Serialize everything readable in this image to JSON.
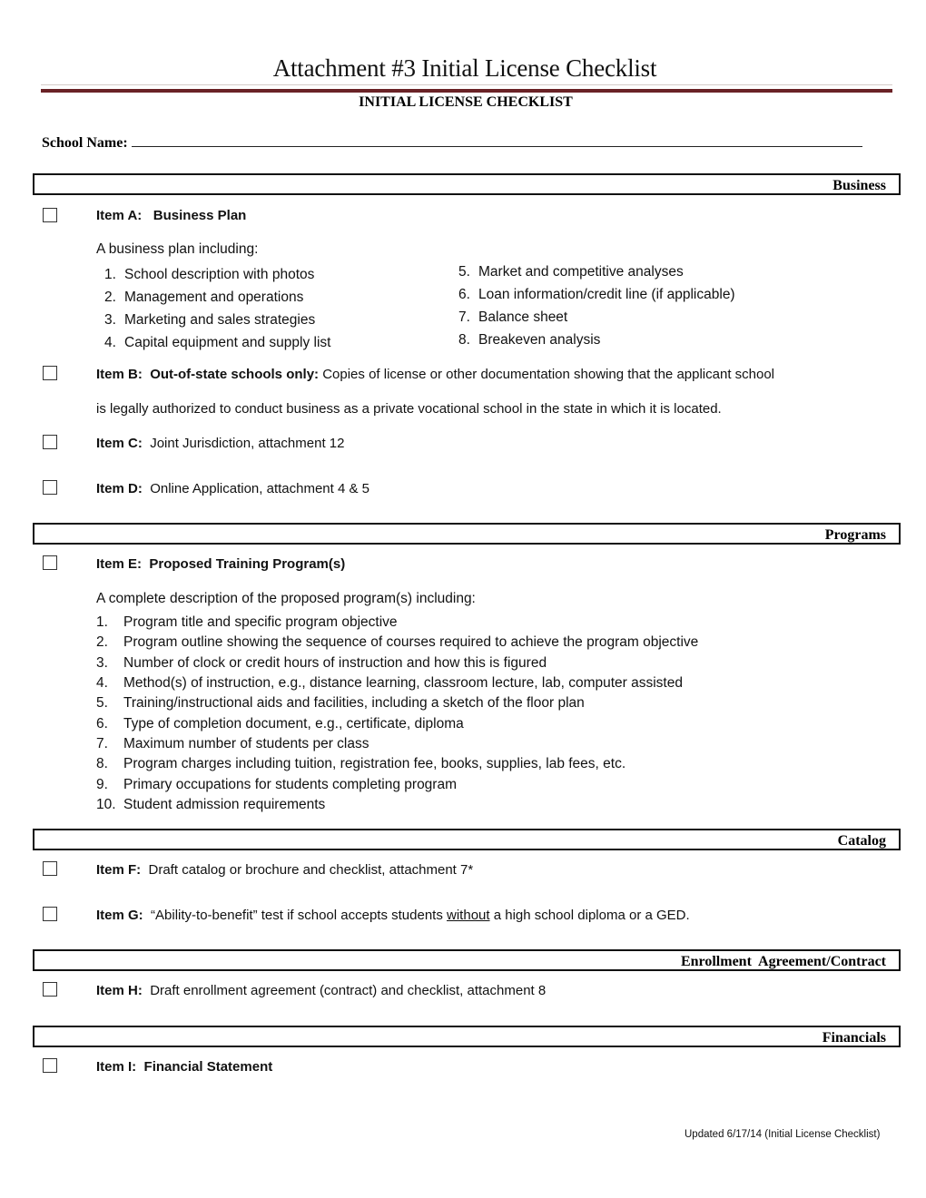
{
  "header": {
    "title": "Attachment #3  Initial License Checklist",
    "subtitle": "INITIAL LICENSE CHECKLIST",
    "rule_colors": {
      "thin": "#d4ccc8",
      "thick": "#6a2226"
    }
  },
  "school_name": {
    "label": "School Name:",
    "value": ""
  },
  "sections": {
    "business": {
      "heading": "Business",
      "item_a": {
        "label": "Item A:",
        "title": "Business Plan",
        "intro": "A business plan including:",
        "list_left": [
          {
            "n": "1.",
            "text": "School description with photos"
          },
          {
            "n": "2.",
            "text": "Management and operations"
          },
          {
            "n": "3.",
            "text": "Marketing and sales strategies"
          },
          {
            "n": "4.",
            "text": "Capital equipment and supply list"
          }
        ],
        "list_right": [
          {
            "n": "5.",
            "text": "Market and competitive analyses"
          },
          {
            "n": "6.",
            "text": "Loan information/credit line (if applicable)"
          },
          {
            "n": "7.",
            "text": "Balance sheet"
          },
          {
            "n": "8.",
            "text": "Breakeven analysis"
          }
        ]
      },
      "item_b": {
        "label": "Item B:",
        "bold": "Out-of-state schools only:",
        "line1": "Copies of license or other documentation showing that the applicant school",
        "line2": "is legally authorized to conduct business as a private vocational school in the state in which it is located."
      },
      "item_c": {
        "label": "Item C:",
        "text": "Joint Jurisdiction, attachment 12"
      },
      "item_d": {
        "label": "Item D:",
        "text": "Online Application, attachment 4 & 5"
      }
    },
    "programs": {
      "heading": "Programs",
      "item_e": {
        "label": "Item E:",
        "title": "Proposed Training Program(s)",
        "intro": "A complete description of the proposed program(s) including:",
        "list": [
          {
            "n": "1.",
            "text": "Program title and specific program objective"
          },
          {
            "n": "2.",
            "text": "Program outline showing the sequence of courses required to achieve the program objective"
          },
          {
            "n": "3.",
            "text": "Number of clock or credit hours of instruction and how this is figured"
          },
          {
            "n": "4.",
            "text": "Method(s) of instruction, e.g., distance learning, classroom lecture, lab, computer assisted"
          },
          {
            "n": "5.",
            "text": "Training/instructional aids and facilities, including a sketch of the floor plan"
          },
          {
            "n": "6.",
            "text": "Type of completion document, e.g., certificate, diploma"
          },
          {
            "n": "7.",
            "text": "Maximum number of students per class"
          },
          {
            "n": "8.",
            "text": "Program charges including tuition, registration fee, books, supplies, lab fees, etc."
          },
          {
            "n": "9.",
            "text": "Primary occupations for students completing program"
          },
          {
            "n": "10.",
            "text": "Student admission requirements"
          }
        ]
      }
    },
    "catalog": {
      "heading": "Catalog",
      "item_f": {
        "label": "Item F:",
        "text": "Draft catalog or brochure and checklist, attachment 7*"
      },
      "item_g": {
        "label": "Item G:",
        "text_before": "“Ability-to-benefit” test if school accepts students ",
        "underlined": "without",
        "text_after": " a high school diploma or a GED."
      }
    },
    "enrollment": {
      "heading": "Enrollment  Agreement/Contract",
      "item_h": {
        "label": "Item H:",
        "text": "Draft enrollment agreement (contract) and checklist, attachment 8"
      }
    },
    "financials": {
      "heading": "Financials",
      "item_i": {
        "label": "Item I:",
        "title": "Financial Statement"
      }
    }
  },
  "checkboxes": {
    "a": false,
    "b": false,
    "c": false,
    "d": false,
    "e": false,
    "f": false,
    "g": false,
    "h": false,
    "i": false
  },
  "footer": {
    "text": "Updated 6/17/14 (Initial License Checklist)"
  }
}
